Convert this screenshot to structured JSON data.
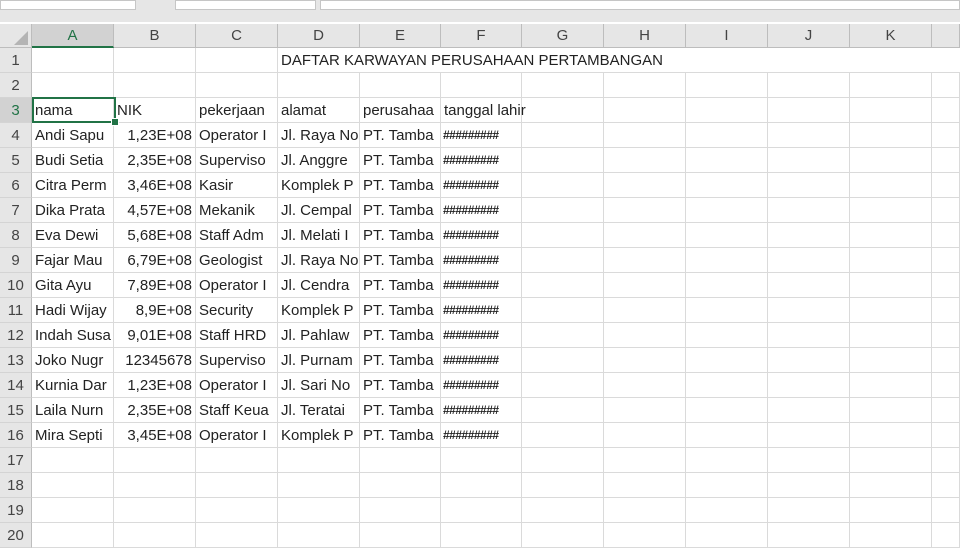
{
  "columns": [
    "A",
    "B",
    "C",
    "D",
    "E",
    "F",
    "G",
    "H",
    "I",
    "J",
    "K",
    ""
  ],
  "rows": [
    "1",
    "2",
    "3",
    "4",
    "5",
    "6",
    "7",
    "8",
    "9",
    "10",
    "11",
    "12",
    "13",
    "14",
    "15",
    "16",
    "17",
    "18",
    "19",
    "20"
  ],
  "title": "DAFTAR KARWAYAN PERUSAHAAN PERTAMBANGAN",
  "headers": [
    "nama",
    "NIK",
    "pekerjaan",
    "alamat",
    "perusahaa",
    "tanggal lahir"
  ],
  "data": [
    [
      "Andi Sapu",
      "1,23E+08",
      "Operator I",
      "Jl. Raya No",
      "PT. Tamba",
      "#########"
    ],
    [
      "Budi Setia",
      "2,35E+08",
      "Superviso",
      "Jl. Anggre",
      "PT. Tamba",
      "#########"
    ],
    [
      "Citra Perm",
      "3,46E+08",
      "Kasir",
      "Komplek P",
      "PT. Tamba",
      "#########"
    ],
    [
      "Dika Prata",
      "4,57E+08",
      "Mekanik",
      "Jl. Cempal",
      "PT. Tamba",
      "#########"
    ],
    [
      "Eva Dewi",
      "5,68E+08",
      "Staff Adm",
      "Jl. Melati I",
      "PT. Tamba",
      "#########"
    ],
    [
      "Fajar Mau",
      "6,79E+08",
      "Geologist",
      "Jl. Raya No",
      "PT. Tamba",
      "#########"
    ],
    [
      "Gita Ayu",
      "7,89E+08",
      "Operator I",
      "Jl. Cendra",
      "PT. Tamba",
      "#########"
    ],
    [
      "Hadi Wijay",
      "8,9E+08",
      "Security",
      "Komplek P",
      "PT. Tamba",
      "#########"
    ],
    [
      "Indah Susa",
      "9,01E+08",
      "Staff HRD",
      "Jl. Pahlaw",
      "PT. Tamba",
      "#########"
    ],
    [
      "Joko Nugr",
      "12345678",
      "Superviso",
      "Jl. Purnam",
      "PT. Tamba",
      "#########"
    ],
    [
      "Kurnia Dar",
      "1,23E+08",
      "Operator I",
      "Jl. Sari No",
      "PT. Tamba",
      "#########"
    ],
    [
      "Laila Nurn",
      "2,35E+08",
      "Staff Keua",
      "Jl. Teratai",
      "PT. Tamba",
      "#########"
    ],
    [
      "Mira Septi",
      "3,45E+08",
      "Operator I",
      "Komplek P",
      "PT. Tamba",
      "#########"
    ]
  ],
  "colors": {
    "accent": "#217346"
  }
}
